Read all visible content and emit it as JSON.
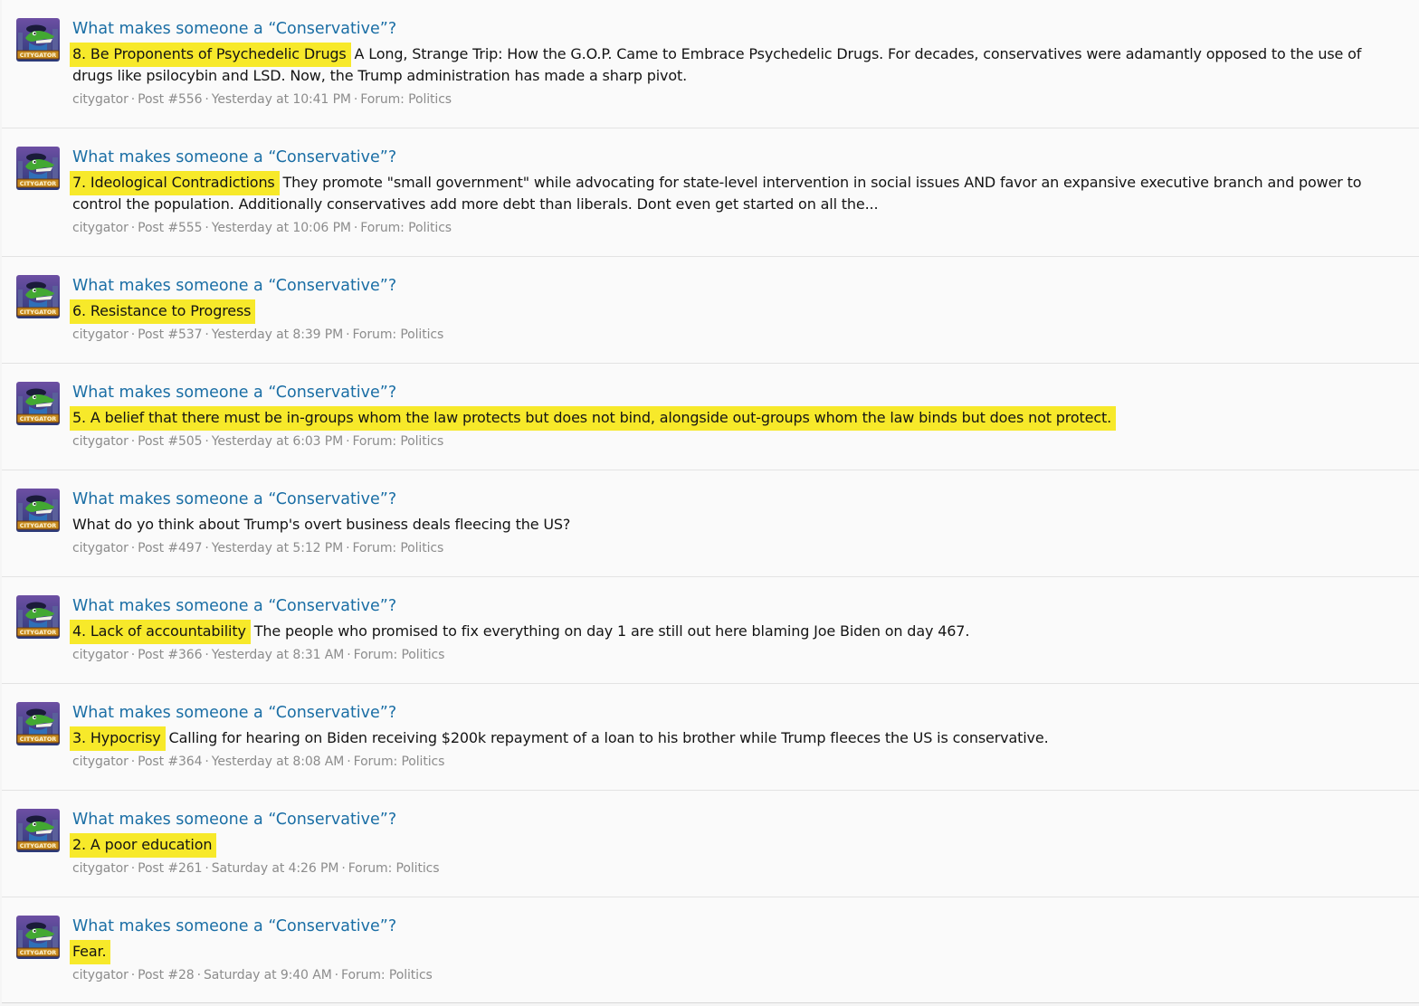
{
  "thread_title": "What makes someone a “Conservative”?",
  "separator": "·",
  "avatar": {
    "label": "CITYGATOR",
    "icon": "alligator-avatar-icon",
    "colors": {
      "bg": "#2b3a78",
      "gator": "#43a832",
      "banner": "#c78a1e",
      "cap": "#1b1b3a"
    }
  },
  "colors": {
    "link": "#1a6ea5",
    "meta": "#8c8c8c",
    "highlight": "#f7e92a"
  },
  "results": [
    {
      "highlight": "8. Be Proponents of Psychedelic Drugs",
      "snippet": " A Long, Strange Trip: How the G.O.P. Came to Embrace Psychedelic Drugs. For decades, conservatives were adamantly opposed to the use of drugs like psilocybin and LSD. Now, the Trump administration has made a sharp pivot.",
      "user": "citygator",
      "post": "Post #556",
      "time": "Yesterday at 10:41 PM",
      "forum": "Forum: Politics"
    },
    {
      "highlight": "7. Ideological Contradictions",
      "snippet": " They promote \"small government\" while advocating for state-level intervention in social issues AND favor an expansive executive branch and power to control the population. Additionally conservatives add more debt than liberals. Dont even get started on all the...",
      "user": "citygator",
      "post": "Post #555",
      "time": "Yesterday at 10:06 PM",
      "forum": "Forum: Politics"
    },
    {
      "highlight": "6. Resistance to Progress",
      "snippet": "",
      "user": "citygator",
      "post": "Post #537",
      "time": "Yesterday at 8:39 PM",
      "forum": "Forum: Politics"
    },
    {
      "highlight": "5. A belief that there must be in-groups whom the law protects but does not bind, alongside out-groups whom the law binds but does not protect.",
      "snippet": "",
      "user": "citygator",
      "post": "Post #505",
      "time": "Yesterday at 6:03 PM",
      "forum": "Forum: Politics"
    },
    {
      "highlight": "",
      "snippet": "What do yo think about Trump's overt business deals fleecing the US?",
      "user": "citygator",
      "post": "Post #497",
      "time": "Yesterday at 5:12 PM",
      "forum": "Forum: Politics"
    },
    {
      "highlight": "4. Lack of accountability",
      "snippet": " The people who promised to fix everything on day 1 are still out here blaming Joe Biden on day 467.",
      "user": "citygator",
      "post": "Post #366",
      "time": "Yesterday at 8:31 AM",
      "forum": "Forum: Politics"
    },
    {
      "highlight": "3. Hypocrisy",
      "snippet": " Calling for hearing on Biden receiving $200k repayment of a loan to his brother while Trump fleeces the US is conservative.",
      "user": "citygator",
      "post": "Post #364",
      "time": "Yesterday at 8:08 AM",
      "forum": "Forum: Politics"
    },
    {
      "highlight": "2. A poor education",
      "snippet": "",
      "user": "citygator",
      "post": "Post #261",
      "time": "Saturday at 4:26 PM",
      "forum": "Forum: Politics"
    },
    {
      "highlight": "Fear.",
      "snippet": "",
      "user": "citygator",
      "post": "Post #28",
      "time": "Saturday at 9:40 AM",
      "forum": "Forum: Politics"
    }
  ]
}
